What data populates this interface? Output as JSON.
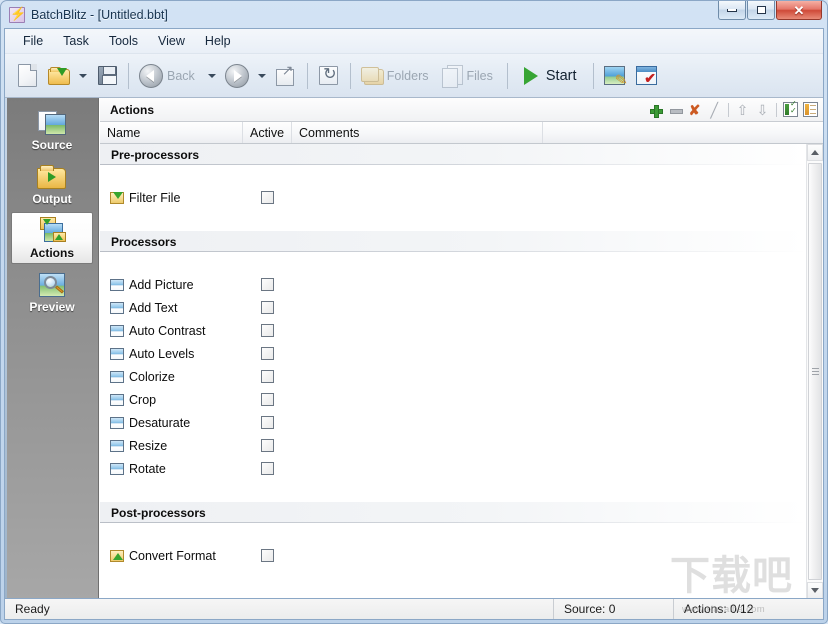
{
  "window": {
    "title": "BatchBlitz - [Untitled.bbt]",
    "app_icon": "lightning-bolt-icon",
    "controls": {
      "minimize": "minimize-icon",
      "maximize": "maximize-icon",
      "close": "close-icon",
      "close_glyph": "✕"
    },
    "colors": {
      "titlebar_gradient_top": "#d3e3f4",
      "titlebar_gradient_bottom": "#bcd2ea",
      "frame_border": "#8ba7c6",
      "close_button": "#cf4a38",
      "sidebar_gradient_top": "#7b7b7b",
      "sidebar_gradient_bottom": "#a7a7a7",
      "accent_green": "#37a534",
      "accent_orange": "#cc5a22"
    }
  },
  "menubar": {
    "items": [
      {
        "label": "File"
      },
      {
        "label": "Task"
      },
      {
        "label": "Tools"
      },
      {
        "label": "View"
      },
      {
        "label": "Help"
      }
    ]
  },
  "toolbar": {
    "items": [
      {
        "name": "new-task-button",
        "icon": "new-document-icon",
        "label": "",
        "enabled": true,
        "dropdown": false
      },
      {
        "name": "open-task-button",
        "icon": "open-folder-icon",
        "label": "",
        "enabled": true,
        "dropdown": true
      },
      {
        "name": "save-task-button",
        "icon": "save-disk-icon",
        "label": "",
        "enabled": true,
        "dropdown": false
      },
      {
        "name": "back-button",
        "icon": "back-arrow-icon",
        "label": "Back",
        "enabled": false,
        "dropdown": true
      },
      {
        "name": "forward-button",
        "icon": "forward-arrow-icon",
        "label": "",
        "enabled": true,
        "dropdown": true
      },
      {
        "name": "up-button",
        "icon": "up-folder-icon",
        "label": "",
        "enabled": true,
        "dropdown": false
      },
      {
        "name": "refresh-button",
        "icon": "refresh-icon",
        "label": "",
        "enabled": true,
        "dropdown": false
      },
      {
        "name": "folders-button",
        "icon": "folders-icon",
        "label": "Folders",
        "enabled": false,
        "dropdown": false
      },
      {
        "name": "files-button",
        "icon": "files-icon",
        "label": "Files",
        "enabled": false,
        "dropdown": false
      },
      {
        "name": "start-button",
        "icon": "play-icon",
        "label": "Start",
        "enabled": true,
        "dropdown": false
      },
      {
        "name": "image-editor-button",
        "icon": "image-edit-icon",
        "label": "",
        "enabled": true,
        "dropdown": false
      },
      {
        "name": "task-list-button",
        "icon": "checklist-icon",
        "label": "",
        "enabled": true,
        "dropdown": false
      }
    ],
    "labels": {
      "back": "Back",
      "folders": "Folders",
      "files": "Files",
      "start": "Start"
    }
  },
  "sidebar": {
    "items": [
      {
        "label": "Source",
        "icon": "picture-stack-icon",
        "selected": false
      },
      {
        "label": "Output",
        "icon": "output-folder-icon",
        "selected": false
      },
      {
        "label": "Actions",
        "icon": "actions-image-icon",
        "selected": true
      },
      {
        "label": "Preview",
        "icon": "preview-magnifier-icon",
        "selected": false
      }
    ]
  },
  "panel": {
    "title": "Actions",
    "tools": [
      {
        "name": "add-action-button",
        "icon": "plus-icon",
        "enabled": true
      },
      {
        "name": "remove-action-button",
        "icon": "minus-icon",
        "enabled": false
      },
      {
        "name": "delete-action-button",
        "icon": "red-x-icon",
        "enabled": true
      },
      {
        "name": "edit-action-button",
        "icon": "pencil-icon",
        "enabled": false
      },
      {
        "name": "move-up-button",
        "icon": "arrow-up-icon",
        "enabled": false
      },
      {
        "name": "move-down-button",
        "icon": "arrow-down-icon",
        "enabled": false
      },
      {
        "name": "check-all-button",
        "icon": "checklist-green-icon",
        "enabled": true
      },
      {
        "name": "uncheck-all-button",
        "icon": "list-orange-icon",
        "enabled": true
      }
    ],
    "columns": [
      {
        "label": "Name"
      },
      {
        "label": "Active"
      },
      {
        "label": "Comments"
      },
      {
        "label": ""
      }
    ],
    "groups": [
      {
        "label": "Pre-processors",
        "rows": [
          {
            "name": "Filter File",
            "icon": "filter-file-icon",
            "active": false,
            "comments": ""
          }
        ]
      },
      {
        "label": "Processors",
        "rows": [
          {
            "name": "Add Picture",
            "icon": "image-icon",
            "active": false,
            "comments": ""
          },
          {
            "name": "Add Text",
            "icon": "image-icon",
            "active": false,
            "comments": ""
          },
          {
            "name": "Auto Contrast",
            "icon": "image-icon",
            "active": false,
            "comments": ""
          },
          {
            "name": "Auto Levels",
            "icon": "image-icon",
            "active": false,
            "comments": ""
          },
          {
            "name": "Colorize",
            "icon": "image-icon",
            "active": false,
            "comments": ""
          },
          {
            "name": "Crop",
            "icon": "image-icon",
            "active": false,
            "comments": ""
          },
          {
            "name": "Desaturate",
            "icon": "image-icon",
            "active": false,
            "comments": ""
          },
          {
            "name": "Resize",
            "icon": "image-icon",
            "active": false,
            "comments": ""
          },
          {
            "name": "Rotate",
            "icon": "image-icon",
            "active": false,
            "comments": ""
          }
        ]
      },
      {
        "label": "Post-processors",
        "rows": [
          {
            "name": "Convert Format",
            "icon": "convert-format-icon",
            "active": false,
            "comments": ""
          }
        ]
      }
    ]
  },
  "statusbar": {
    "message": "Ready",
    "source": "Source: 0",
    "actions": "Actions: 0/12"
  },
  "watermark": {
    "text_cn": "下载吧",
    "url": "www.xiazaiba.com"
  }
}
